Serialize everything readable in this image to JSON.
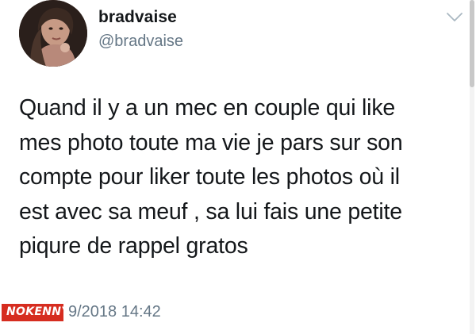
{
  "user": {
    "display_name": "bradvaise",
    "handle": "@bradvaise",
    "avatar_icon": "profile-photo"
  },
  "menu": {
    "icon": "chevron-down-icon"
  },
  "tweet": {
    "lines": [
      "Quand il y a un mec en couple qui like",
      "mes photo toute ma vie je pars sur son",
      "compte pour liker toute les photos où il",
      "est avec sa meuf , sa lui fais une petite",
      "piqure de rappel gratos"
    ]
  },
  "meta": {
    "timestamp": "9/2018 14:42"
  },
  "watermark": {
    "text": "NOKENNY"
  },
  "colors": {
    "text": "#14171a",
    "secondary": "#657786",
    "watermark_bg": "#d62d20"
  }
}
